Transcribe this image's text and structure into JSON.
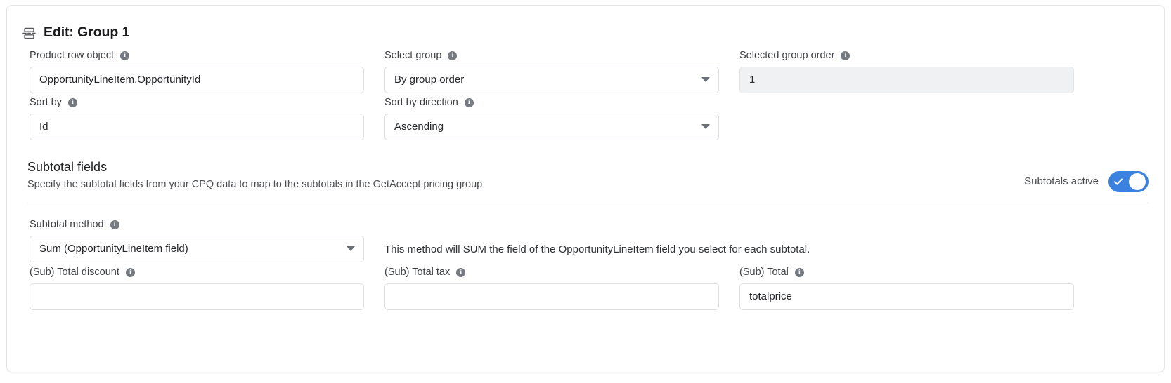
{
  "header": {
    "icon": "rows-icon",
    "title": "Edit: Group 1"
  },
  "form": {
    "fields": [
      {
        "name": "product-row-object",
        "label": "Product row object",
        "info": "i",
        "type": "text",
        "value": "OpportunityLineItem.OpportunityId",
        "disabled": false
      },
      {
        "name": "select-group",
        "label": "Select group",
        "info": "i",
        "type": "select",
        "value": "By group order",
        "disabled": false
      },
      {
        "name": "selected-group-order",
        "label": "Selected group order",
        "info": "i",
        "type": "text",
        "value": "1",
        "disabled": true
      },
      {
        "name": "sort-by",
        "label": "Sort by",
        "info": "i",
        "type": "text",
        "value": "Id",
        "disabled": false
      },
      {
        "name": "sort-by-direction",
        "label": "Sort by direction",
        "info": "i",
        "type": "select",
        "value": "Ascending",
        "disabled": false
      }
    ]
  },
  "subtotals": {
    "title": "Subtotal fields",
    "description": "Specify the subtotal fields from your CPQ data to map to the subtotals in the GetAccept pricing group",
    "toggle_label": "Subtotals active",
    "toggle_on": true,
    "toggle_color": "#3b82e0",
    "method": {
      "label": "Subtotal method",
      "info": "i",
      "value": "Sum (OpportunityLineItem field)",
      "help": "This method will SUM the field of the OpportunityLineItem field you select for each subtotal."
    },
    "fields": [
      {
        "name": "sub-total-discount",
        "label": "(Sub) Total discount",
        "info": "i",
        "value": "",
        "placeholder": ""
      },
      {
        "name": "sub-total-tax",
        "label": "(Sub) Total tax",
        "info": "i",
        "value": "",
        "placeholder": ""
      },
      {
        "name": "sub-total",
        "label": "(Sub) Total",
        "info": "i",
        "value": "totalprice",
        "placeholder": ""
      }
    ]
  }
}
